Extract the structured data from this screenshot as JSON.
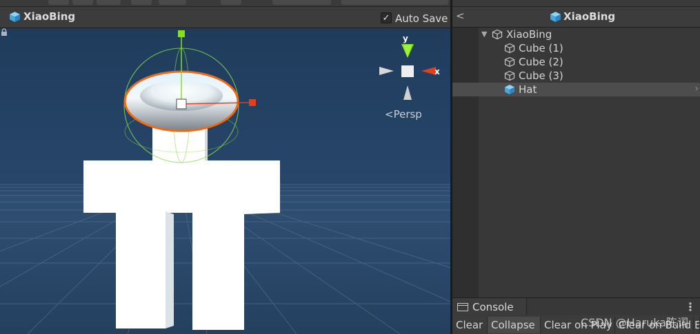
{
  "scene": {
    "prefab_title": "XiaoBing",
    "autosave_label": "Auto Save",
    "autosave_checked": true,
    "persp_label": "Persp",
    "gizmo_axis_y": "y",
    "gizmo_axis_x": "x"
  },
  "hierarchy": {
    "title": "XiaoBing",
    "back": "<",
    "items": [
      {
        "label": "XiaoBing",
        "expanded": true,
        "icon": "cube-outline-icon"
      },
      {
        "label": "Cube (1)",
        "icon": "cube-outline-icon"
      },
      {
        "label": "Cube (2)",
        "icon": "cube-outline-icon"
      },
      {
        "label": "Cube (3)",
        "icon": "cube-outline-icon"
      },
      {
        "label": "Hat",
        "icon": "cube-blue-icon",
        "selected": true
      }
    ]
  },
  "console": {
    "tab_label": "Console",
    "buttons": [
      "Clear",
      "Collapse",
      "Clear on Play",
      "Clear on Build",
      "E"
    ],
    "active_button": "Collapse"
  },
  "watermark": "CSDN @Haruka陈词",
  "colors": {
    "scene_background": "#24405f",
    "selection_outline": "#f06a14",
    "gizmo_y": "#86e01c",
    "gizmo_x": "#e0401e",
    "prefab_cube": "#5bb8ea"
  }
}
